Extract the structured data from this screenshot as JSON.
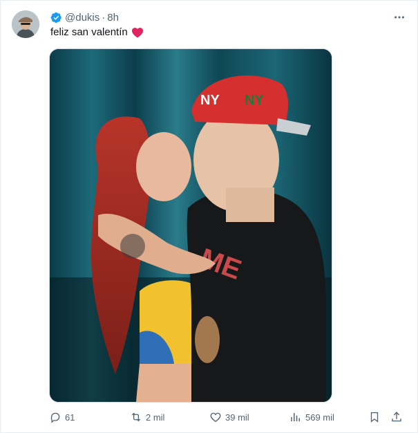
{
  "tweet": {
    "handle": "@dukis",
    "separator": "·",
    "time": "8h",
    "text": "feliz san valentín",
    "emoji_icon": "red-heart-icon",
    "verified_color": "#1d9bf0"
  },
  "actions": {
    "replies": "61",
    "retweets": "2 mil",
    "likes": "39 mil",
    "views": "569 mil"
  },
  "icons": {
    "reply": "reply-icon",
    "retweet": "retweet-icon",
    "like": "like-icon",
    "views": "views-icon",
    "bookmark": "bookmark-icon",
    "share": "share-icon",
    "more": "more-icon"
  },
  "colors": {
    "muted_text": "#536471",
    "heart_red": "#e0245e",
    "border": "#e6ecf0"
  }
}
